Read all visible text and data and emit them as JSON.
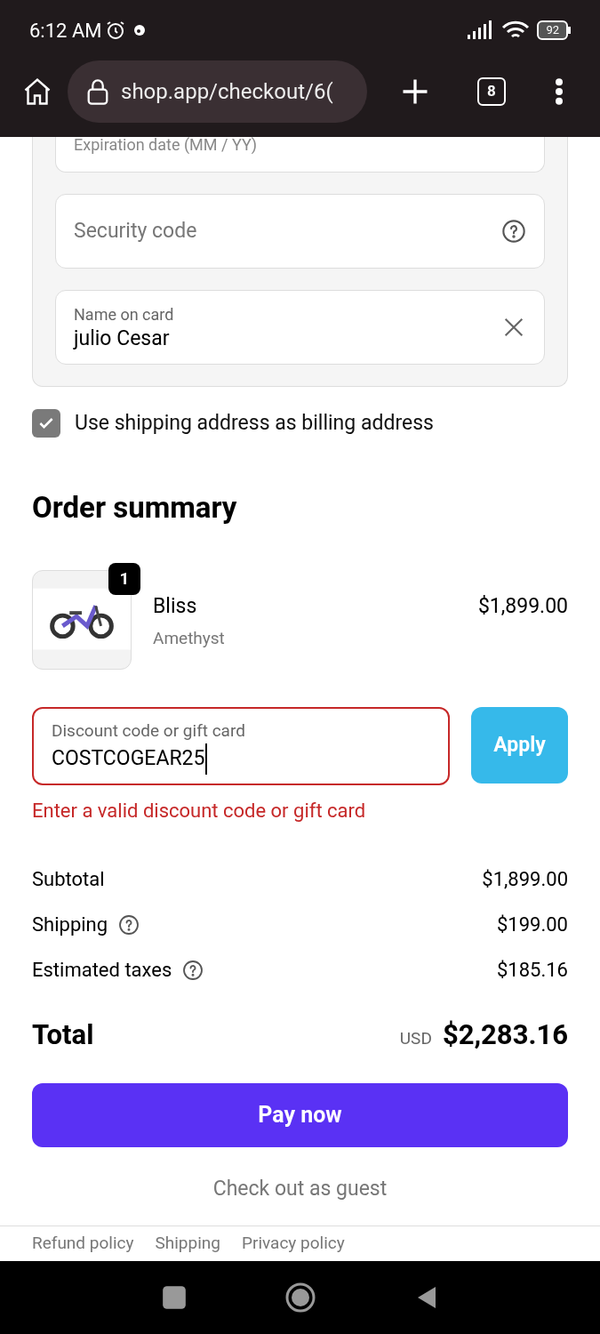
{
  "status_bar": {
    "time": "6:12 AM",
    "battery": "92"
  },
  "browser": {
    "url": "shop.app/checkout/6(",
    "tab_count": "8"
  },
  "payment_fields": [
    {
      "kind": "partial",
      "placeholder": "Expiration date (MM / YY)"
    },
    {
      "kind": "help",
      "placeholder": "Security code"
    },
    {
      "kind": "clearable",
      "label": "Name on card",
      "value": "julio Cesar"
    }
  ],
  "billing_checkbox": {
    "label": "Use shipping address as billing address",
    "checked": true
  },
  "order_summary": {
    "title": "Order summary",
    "items": [
      {
        "quantity": "1",
        "name": "Bliss",
        "variant": "Amethyst",
        "price": "$1,899.00"
      }
    ],
    "discount": {
      "label": "Discount code or gift card",
      "value": "COSTCOGEAR25",
      "invalid": true,
      "error": "Enter a valid discount code or gift card",
      "button": "Apply"
    },
    "lines": [
      {
        "label": "Subtotal",
        "help": false,
        "amount": "$1,899.00"
      },
      {
        "label": "Shipping",
        "help": true,
        "amount": "$199.00"
      },
      {
        "label": "Estimated taxes",
        "help": true,
        "amount": "$185.16"
      }
    ],
    "total": {
      "label": "Total",
      "currency": "USD",
      "amount": "$2,283.16"
    }
  },
  "pay_button": "Pay now",
  "guest_link": "Check out as guest",
  "footer_links": [
    "Refund policy",
    "Shipping",
    "Privacy policy"
  ]
}
